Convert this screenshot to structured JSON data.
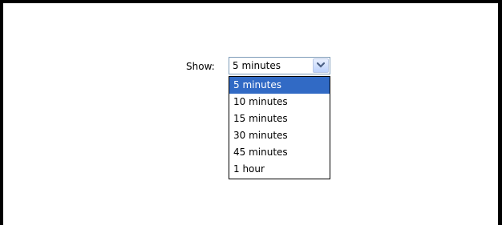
{
  "filter": {
    "label": "Show:",
    "selected_value": "5 minutes",
    "dropdown_icon": "chevron-down-icon",
    "options": [
      {
        "label": "5 minutes",
        "highlighted": true
      },
      {
        "label": "10 minutes",
        "highlighted": false
      },
      {
        "label": "15 minutes",
        "highlighted": false
      },
      {
        "label": "30 minutes",
        "highlighted": false
      },
      {
        "label": "45 minutes",
        "highlighted": false
      },
      {
        "label": "1 hour",
        "highlighted": false
      }
    ]
  },
  "colors": {
    "highlight": "#316ac5",
    "select_border": "#7f9db9",
    "arrow": "#4d6185"
  }
}
